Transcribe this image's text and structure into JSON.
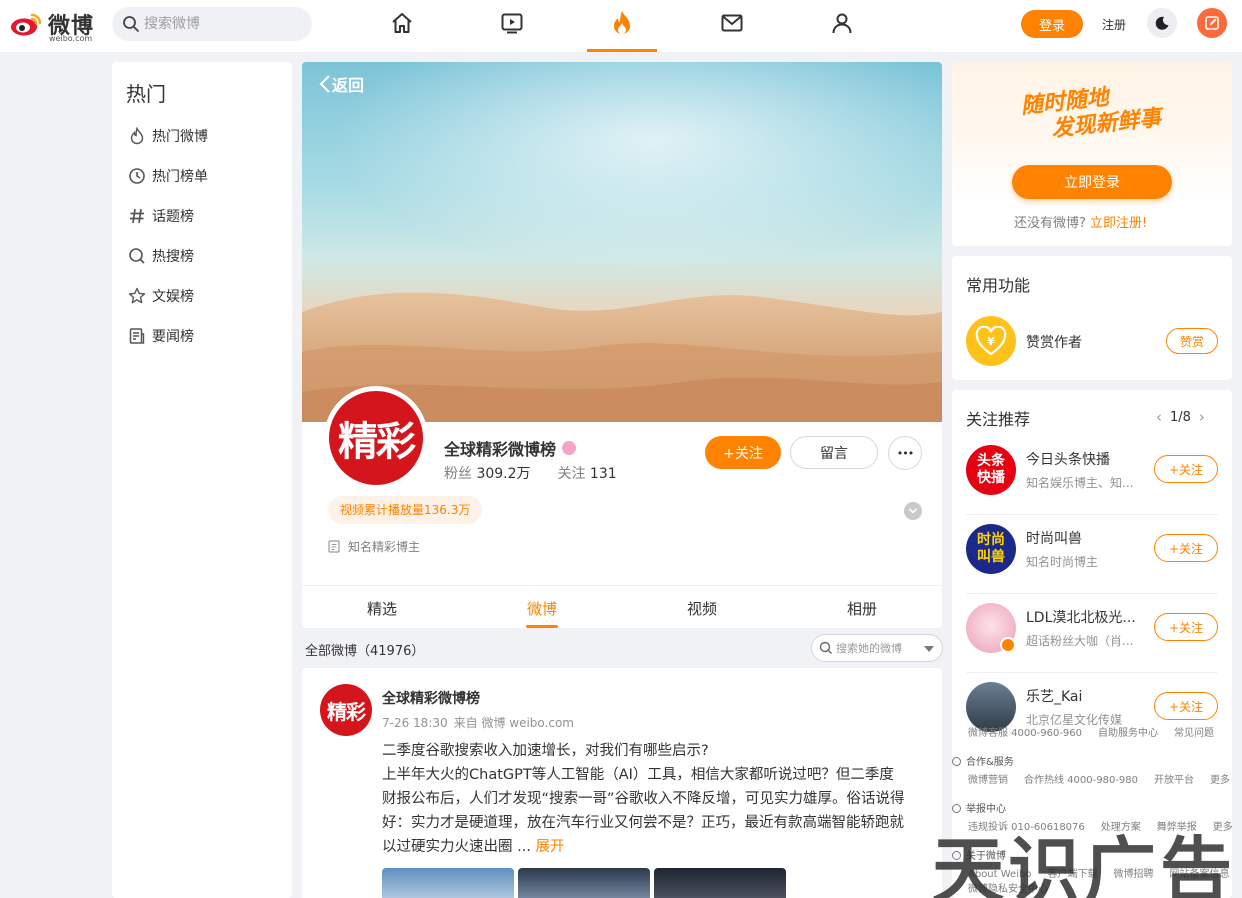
{
  "header": {
    "logo_text": "微博",
    "logo_sub": "weibo.com",
    "search_placeholder": "搜索微博",
    "login_label": "登录",
    "register_label": "注册",
    "nav_icons": [
      "home-icon",
      "video-icon",
      "hot-icon",
      "mail-icon",
      "profile-icon"
    ],
    "accent_color": "#ff8200"
  },
  "sidebar": {
    "title": "热门",
    "items": [
      {
        "label": "热门微博",
        "icon": "flame-icon"
      },
      {
        "label": "热门榜单",
        "icon": "clock-icon"
      },
      {
        "label": "话题榜",
        "icon": "hashtag-icon"
      },
      {
        "label": "热搜榜",
        "icon": "search-icon"
      },
      {
        "label": "文娱榜",
        "icon": "star-icon"
      },
      {
        "label": "要闻榜",
        "icon": "news-icon"
      }
    ]
  },
  "profile": {
    "back_label": "返回",
    "avatar_text": "精彩",
    "name": "全球精彩微博榜",
    "fans_label": "粉丝",
    "fans_value": "309.2万",
    "following_label": "关注",
    "following_value": "131",
    "follow_button": "+关注",
    "message_button": "留言",
    "more_button": "•••",
    "play_count": "视频累计播放量136.3万",
    "description": "知名精彩博主",
    "tabs": [
      {
        "label": "精选",
        "active": false
      },
      {
        "label": "微博",
        "active": true
      },
      {
        "label": "视频",
        "active": false
      },
      {
        "label": "相册",
        "active": false
      }
    ]
  },
  "feed_header": {
    "all_posts_label": "全部微博（41976）",
    "search_placeholder": "搜索她的微博"
  },
  "post": {
    "avatar_text": "精彩",
    "author": "全球精彩微博榜",
    "time": "7-26 18:30",
    "source": "来自 微博 weibo.com",
    "lines": [
      "二季度谷歌搜索收入加速增长，对我们有哪些启示?",
      "上半年大火的ChatGPT等人工智能（AI）工具，相信大家都听说过吧？但二季度",
      "财报公布后，人们才发现“搜索一哥”谷歌收入不降反增，可见实力雄厚。俗话说得",
      "好：实力才是硬道理，放在汽车行业又何尝不是？正巧，最近有款高端智能轿跑就",
      "以过硬实力火速出圈 ..."
    ],
    "expand_label": "展开"
  },
  "right": {
    "slogan_line1": "随时随地",
    "slogan_line2": "发现新鲜事",
    "login_now": "立即登录",
    "no_account": "还没有微博?",
    "register_now": "立即注册!",
    "common_title": "常用功能",
    "zan_label": "赞赏作者",
    "zan_button": "赞赏",
    "rec_title": "关注推荐",
    "rec_page": "1/8",
    "recommendations": [
      {
        "name": "今日头条快播",
        "desc": "知名娱乐博主、知...",
        "avatar": "头条快播",
        "button": "+关注"
      },
      {
        "name": "时尚叫兽",
        "desc": "知名时尚博主",
        "avatar": "时尚叫兽",
        "button": "+关注"
      },
      {
        "name": "LDL漠北北极光...",
        "desc": "超话粉丝大咖（肖...",
        "avatar": "",
        "button": "+关注"
      },
      {
        "name": "乐艺_Kai",
        "desc": "北京亿星文化传媒",
        "avatar": "",
        "button": "+关注"
      }
    ]
  },
  "footer": {
    "row1": [
      "微博客服 4000-960-960",
      "自助服务中心",
      "常见问题"
    ],
    "coop_title": "合作&服务",
    "row2": [
      "微博营销",
      "合作热线 4000-980-980",
      "开放平台",
      "更多"
    ],
    "report_title": "举报中心",
    "row3": [
      "违规投诉 010-60618076",
      "处理方案",
      "舞弊举报",
      "更多"
    ],
    "about_title": "关于微博",
    "row4": [
      "About Weibo",
      "客户端下载",
      "微博招聘",
      "网站备案信息"
    ],
    "row5": "微博隐私安全中心",
    "watermark": "天识广告"
  }
}
